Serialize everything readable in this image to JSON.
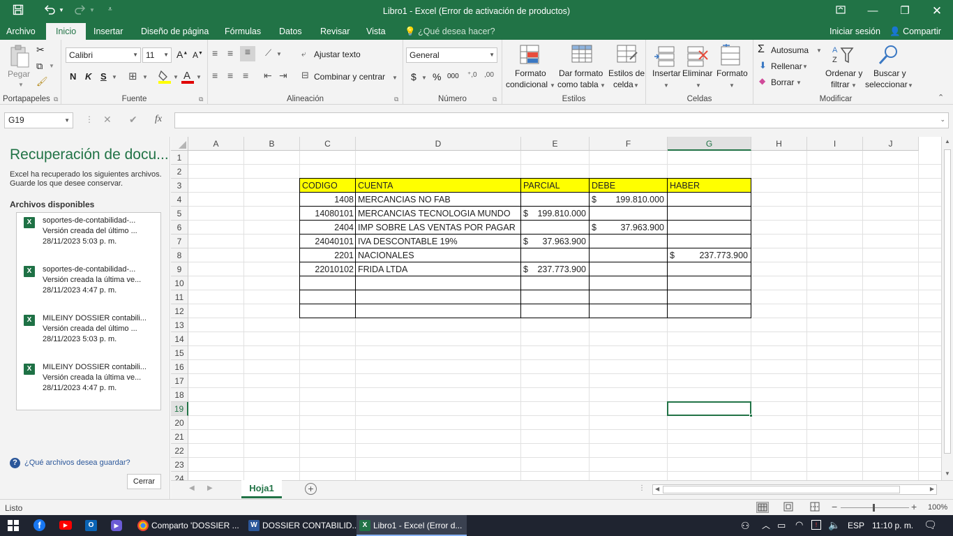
{
  "window": {
    "title": "Libro1 - Excel (Error de activación de productos)"
  },
  "menu": {
    "tabs": [
      "Archivo",
      "Inicio",
      "Insertar",
      "Diseño de página",
      "Fórmulas",
      "Datos",
      "Revisar",
      "Vista"
    ],
    "tell_me": "¿Qué desea hacer?",
    "signin": "Iniciar sesión",
    "share": "Compartir"
  },
  "ribbon": {
    "paste_label": "Pegar",
    "clipboard_group": "Portapapeles",
    "font_name": "Calibri",
    "font_size": "11",
    "bold": "N",
    "italic": "K",
    "underline": "S",
    "font_group": "Fuente",
    "wrap_text": "Ajustar texto",
    "merge_center": "Combinar y centrar",
    "alignment_group": "Alineación",
    "number_format": "General",
    "currency": "$",
    "percent": "%",
    "thousands": "000",
    "number_group": "Número",
    "cond_format_1": "Formato",
    "cond_format_2": "condicional",
    "format_table_1": "Dar formato",
    "format_table_2": "como tabla",
    "cell_styles_1": "Estilos de",
    "cell_styles_2": "celda",
    "styles_group": "Estilos",
    "insert": "Insertar",
    "delete": "Eliminar",
    "format": "Formato",
    "cells_group": "Celdas",
    "autosum": "Autosuma",
    "fill": "Rellenar",
    "clear": "Borrar",
    "sort_1": "Ordenar y",
    "sort_2": "filtrar",
    "find_1": "Buscar y",
    "find_2": "seleccionar",
    "edit_group": "Modificar"
  },
  "formula_bar": {
    "name_box": "G19",
    "fx": "fx",
    "formula": ""
  },
  "recovery": {
    "title": "Recuperación de docu...",
    "subtitle": "Excel ha recuperado los siguientes archivos. Guarde los que desee conservar.",
    "available": "Archivos disponibles",
    "files": [
      {
        "name": "soportes-de-contabilidad-...",
        "version": "Versión creada del último ...",
        "date": "28/11/2023 5:03 p. m."
      },
      {
        "name": "soportes-de-contabilidad-...",
        "version": "Versión creada la última ve...",
        "date": "28/11/2023 4:47 p. m."
      },
      {
        "name": "MILEINY DOSSIER contabili...",
        "version": "Versión creada del último ...",
        "date": "28/11/2023 5:03 p. m."
      },
      {
        "name": "MILEINY DOSSIER contabili...",
        "version": "Versión creada la última ve...",
        "date": "28/11/2023 4:47 p. m."
      }
    ],
    "help": "¿Qué archivos desea guardar?",
    "close": "Cerrar"
  },
  "sheet": {
    "columns": [
      "A",
      "B",
      "C",
      "D",
      "E",
      "F",
      "G",
      "H",
      "I",
      "J"
    ],
    "rows": [
      "1",
      "2",
      "3",
      "4",
      "5",
      "6",
      "7",
      "8",
      "9",
      "10",
      "11",
      "12",
      "13",
      "14",
      "15",
      "16",
      "17",
      "18",
      "19",
      "20",
      "21",
      "22",
      "23",
      "24"
    ],
    "headers": [
      "CODIGO",
      "CUENTA",
      "PARCIAL",
      "DEBE",
      "HABER"
    ],
    "data": [
      {
        "code": "1408",
        "account": "MERCANCIAS NO FAB",
        "partial": "",
        "debit": "199.810.000",
        "credit": ""
      },
      {
        "code": "14080101",
        "account": "MERCANCIAS TECNOLOGIA MUNDO",
        "partial": "199.810.000",
        "debit": "",
        "credit": ""
      },
      {
        "code": "2404",
        "account": "IMP SOBRE LAS VENTAS POR PAGAR",
        "partial": "",
        "debit": "37.963.900",
        "credit": ""
      },
      {
        "code": "24040101",
        "account": "IVA DESCONTABLE 19%",
        "partial": "37.963.900",
        "debit": "",
        "credit": ""
      },
      {
        "code": "2201",
        "account": "NACIONALES",
        "partial": "",
        "debit": "",
        "credit": "237.773.900"
      },
      {
        "code": "22010102",
        "account": "FRIDA LTDA",
        "partial": "237.773.900",
        "debit": "",
        "credit": ""
      }
    ],
    "currency_symbol": "$",
    "tab": "Hoja1"
  },
  "status": {
    "ready": "Listo",
    "zoom": "100%"
  },
  "taskbar": {
    "apps": [
      "Comparto 'DOSSIER ...",
      "DOSSIER CONTABILID...",
      "Libro1 - Excel (Error d..."
    ],
    "lang": "ESP",
    "time": "11:10 p. m."
  },
  "colors": {
    "excel_green": "#217346",
    "header_yellow": "#ffff00"
  }
}
